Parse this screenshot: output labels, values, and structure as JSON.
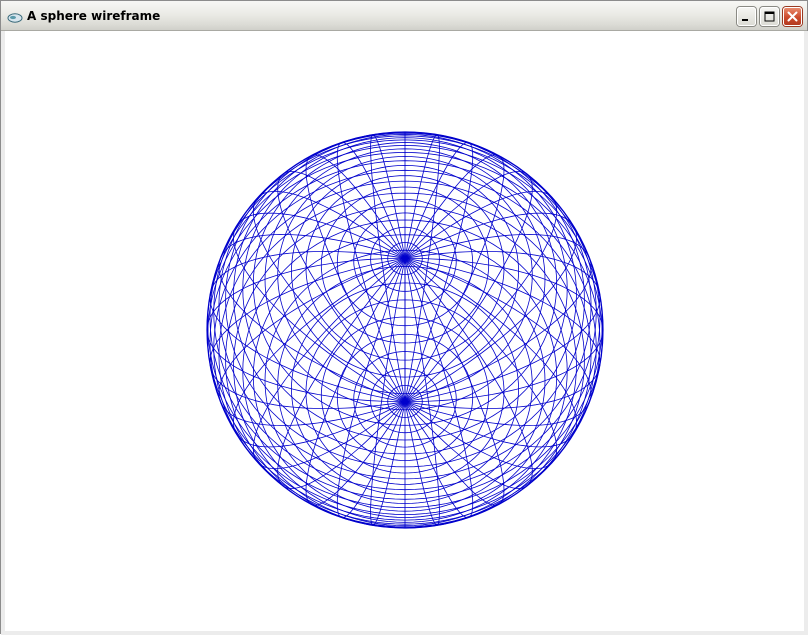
{
  "window": {
    "title": "A sphere wireframe",
    "app_icon": "gear-app-icon"
  },
  "title_buttons": {
    "minimize": "minimize-icon",
    "maximize": "maximize-icon",
    "close": "close-icon"
  },
  "scene": {
    "object": "sphere",
    "style": "wireframe",
    "line_color": "#0000cc",
    "background": "#ffffff",
    "latitude_lines": 36,
    "longitude_lines": 36
  }
}
